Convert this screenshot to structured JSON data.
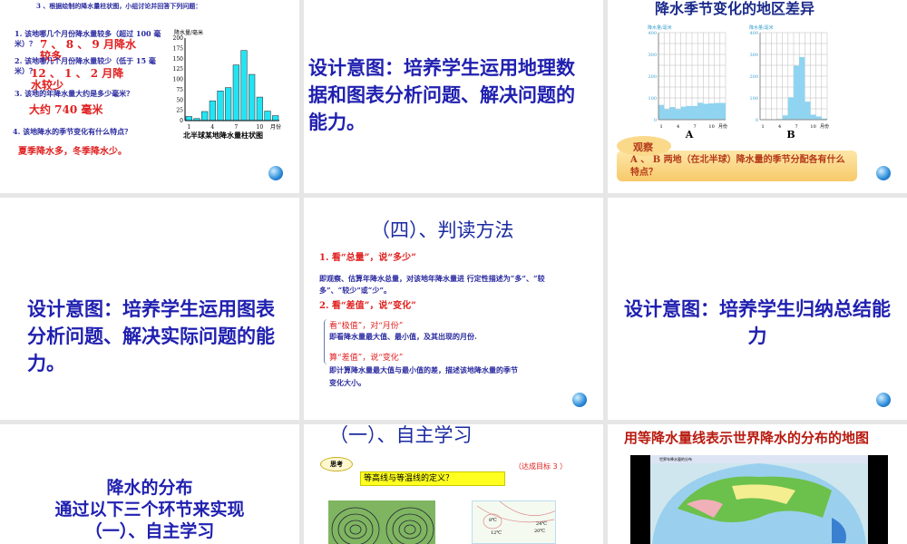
{
  "slide1": {
    "heading": "3 、根据绘制的降水量柱状图，小组讨论并回答下列问题：",
    "q1": "1. 该地哪几个月份降水量较多（超过 100 毫米）？",
    "a1": "7 、 8 、 9 月降水较多",
    "q2": "2. 该地哪几个月份降水量较少（低于 15 毫米）？",
    "a2": "12 、 1 、 2 月降水较少",
    "q3": "3. 该地的年降水量大约是多少毫米？",
    "a3": "大约 740 毫米",
    "q4": "4. 该地降水的季节变化有什么特点？",
    "a4": "夏季降水多，冬季降水少。"
  },
  "slide2": {
    "text": "设计意图：培养学生运用地理数据和图表分析问题、解决问题的能力。"
  },
  "slide3": {
    "title": "降水季节变化的地区差异",
    "bubble": "观察",
    "question": "A 、 B 两地（在北半球）降水量的季节分配各有什么特点？"
  },
  "slide4": {
    "text": "设计意图：培养学生运用图表分析问题、解决实际问题的能力。"
  },
  "slide5": {
    "title": "（四）、判读方法",
    "p1": "1. 看“总量”，说“多少”",
    "p1_desc": "即观察、估算年降水总量，对该地年降水量进 行定性描述为“多”、“较多”、“较少”或“少”。",
    "p2": "2. 看“差值”，说“变化”",
    "p2a": "看“极值”，对“月份”",
    "p2a_desc": "即看降水量最大值、最小值，及其出现的月份.",
    "p2b": "算“差值”，说“变化”",
    "p2b_desc": "即计算降水量最大值与最小值的差，描述该地降水量的季节变化大小。"
  },
  "slide6": {
    "text": "设计意图：培养学生归纳总结能力"
  },
  "slide7": {
    "line1": "降水的分布",
    "line2": "通过以下三个环节来实现",
    "line3": "（一）、自主学习"
  },
  "slide8": {
    "title": "（一）、自主学习",
    "bubble": "思考",
    "goal": "（达成目标 3 ）",
    "question": "等高线与等温线的定义？",
    "isotherms": [
      "8℃",
      "12℃",
      "24℃",
      "20℃"
    ]
  },
  "slide9": {
    "title": "用等降水量线表示世界降水的分布的地图",
    "window_title": "世界年降水量的分布"
  },
  "chart_data": [
    {
      "type": "bar",
      "title": "北半球某地降水量柱状图",
      "ylabel": "降水量/毫米",
      "xlabel": "月份",
      "categories": [
        "1",
        "2",
        "3",
        "4",
        "5",
        "6",
        "7",
        "8",
        "9",
        "10",
        "11",
        "12"
      ],
      "values": [
        10,
        5,
        22,
        48,
        72,
        80,
        135,
        170,
        112,
        57,
        23,
        12
      ],
      "ylim": [
        0,
        200
      ],
      "yticks": [
        "0",
        "25",
        "50",
        "75",
        "100",
        "125",
        "150",
        "175",
        "200"
      ],
      "xticks": [
        "1",
        "4",
        "7",
        "10"
      ]
    },
    {
      "type": "bar",
      "title": "A",
      "ylabel": "降水量/毫米",
      "xlabel": "月份",
      "categories": [
        "1",
        "2",
        "3",
        "4",
        "5",
        "6",
        "7",
        "8",
        "9",
        "10",
        "11",
        "12"
      ],
      "values": [
        68,
        48,
        58,
        48,
        60,
        63,
        63,
        78,
        73,
        75,
        77,
        77
      ],
      "ylim": [
        0,
        400
      ],
      "yticks": [
        "0",
        "100",
        "200",
        "300",
        "400"
      ],
      "xticks": [
        "1",
        "4",
        "7",
        "10"
      ]
    },
    {
      "type": "bar",
      "title": "B",
      "ylabel": "降水量/毫米",
      "xlabel": "月份",
      "categories": [
        "1",
        "2",
        "3",
        "4",
        "5",
        "6",
        "7",
        "8",
        "9",
        "10",
        "11",
        "12"
      ],
      "values": [
        2,
        1,
        1,
        3,
        20,
        103,
        248,
        288,
        83,
        23,
        15,
        5
      ],
      "ylim": [
        0,
        400
      ],
      "yticks": [
        "0",
        "100",
        "200",
        "300",
        "400"
      ],
      "xticks": [
        "1",
        "4",
        "7",
        "10"
      ]
    }
  ],
  "colors": {
    "bar1": "#22e4f4",
    "bar2": "#8fd4f0",
    "title_blue": "#2020b0",
    "answer_red": "#e02020"
  }
}
